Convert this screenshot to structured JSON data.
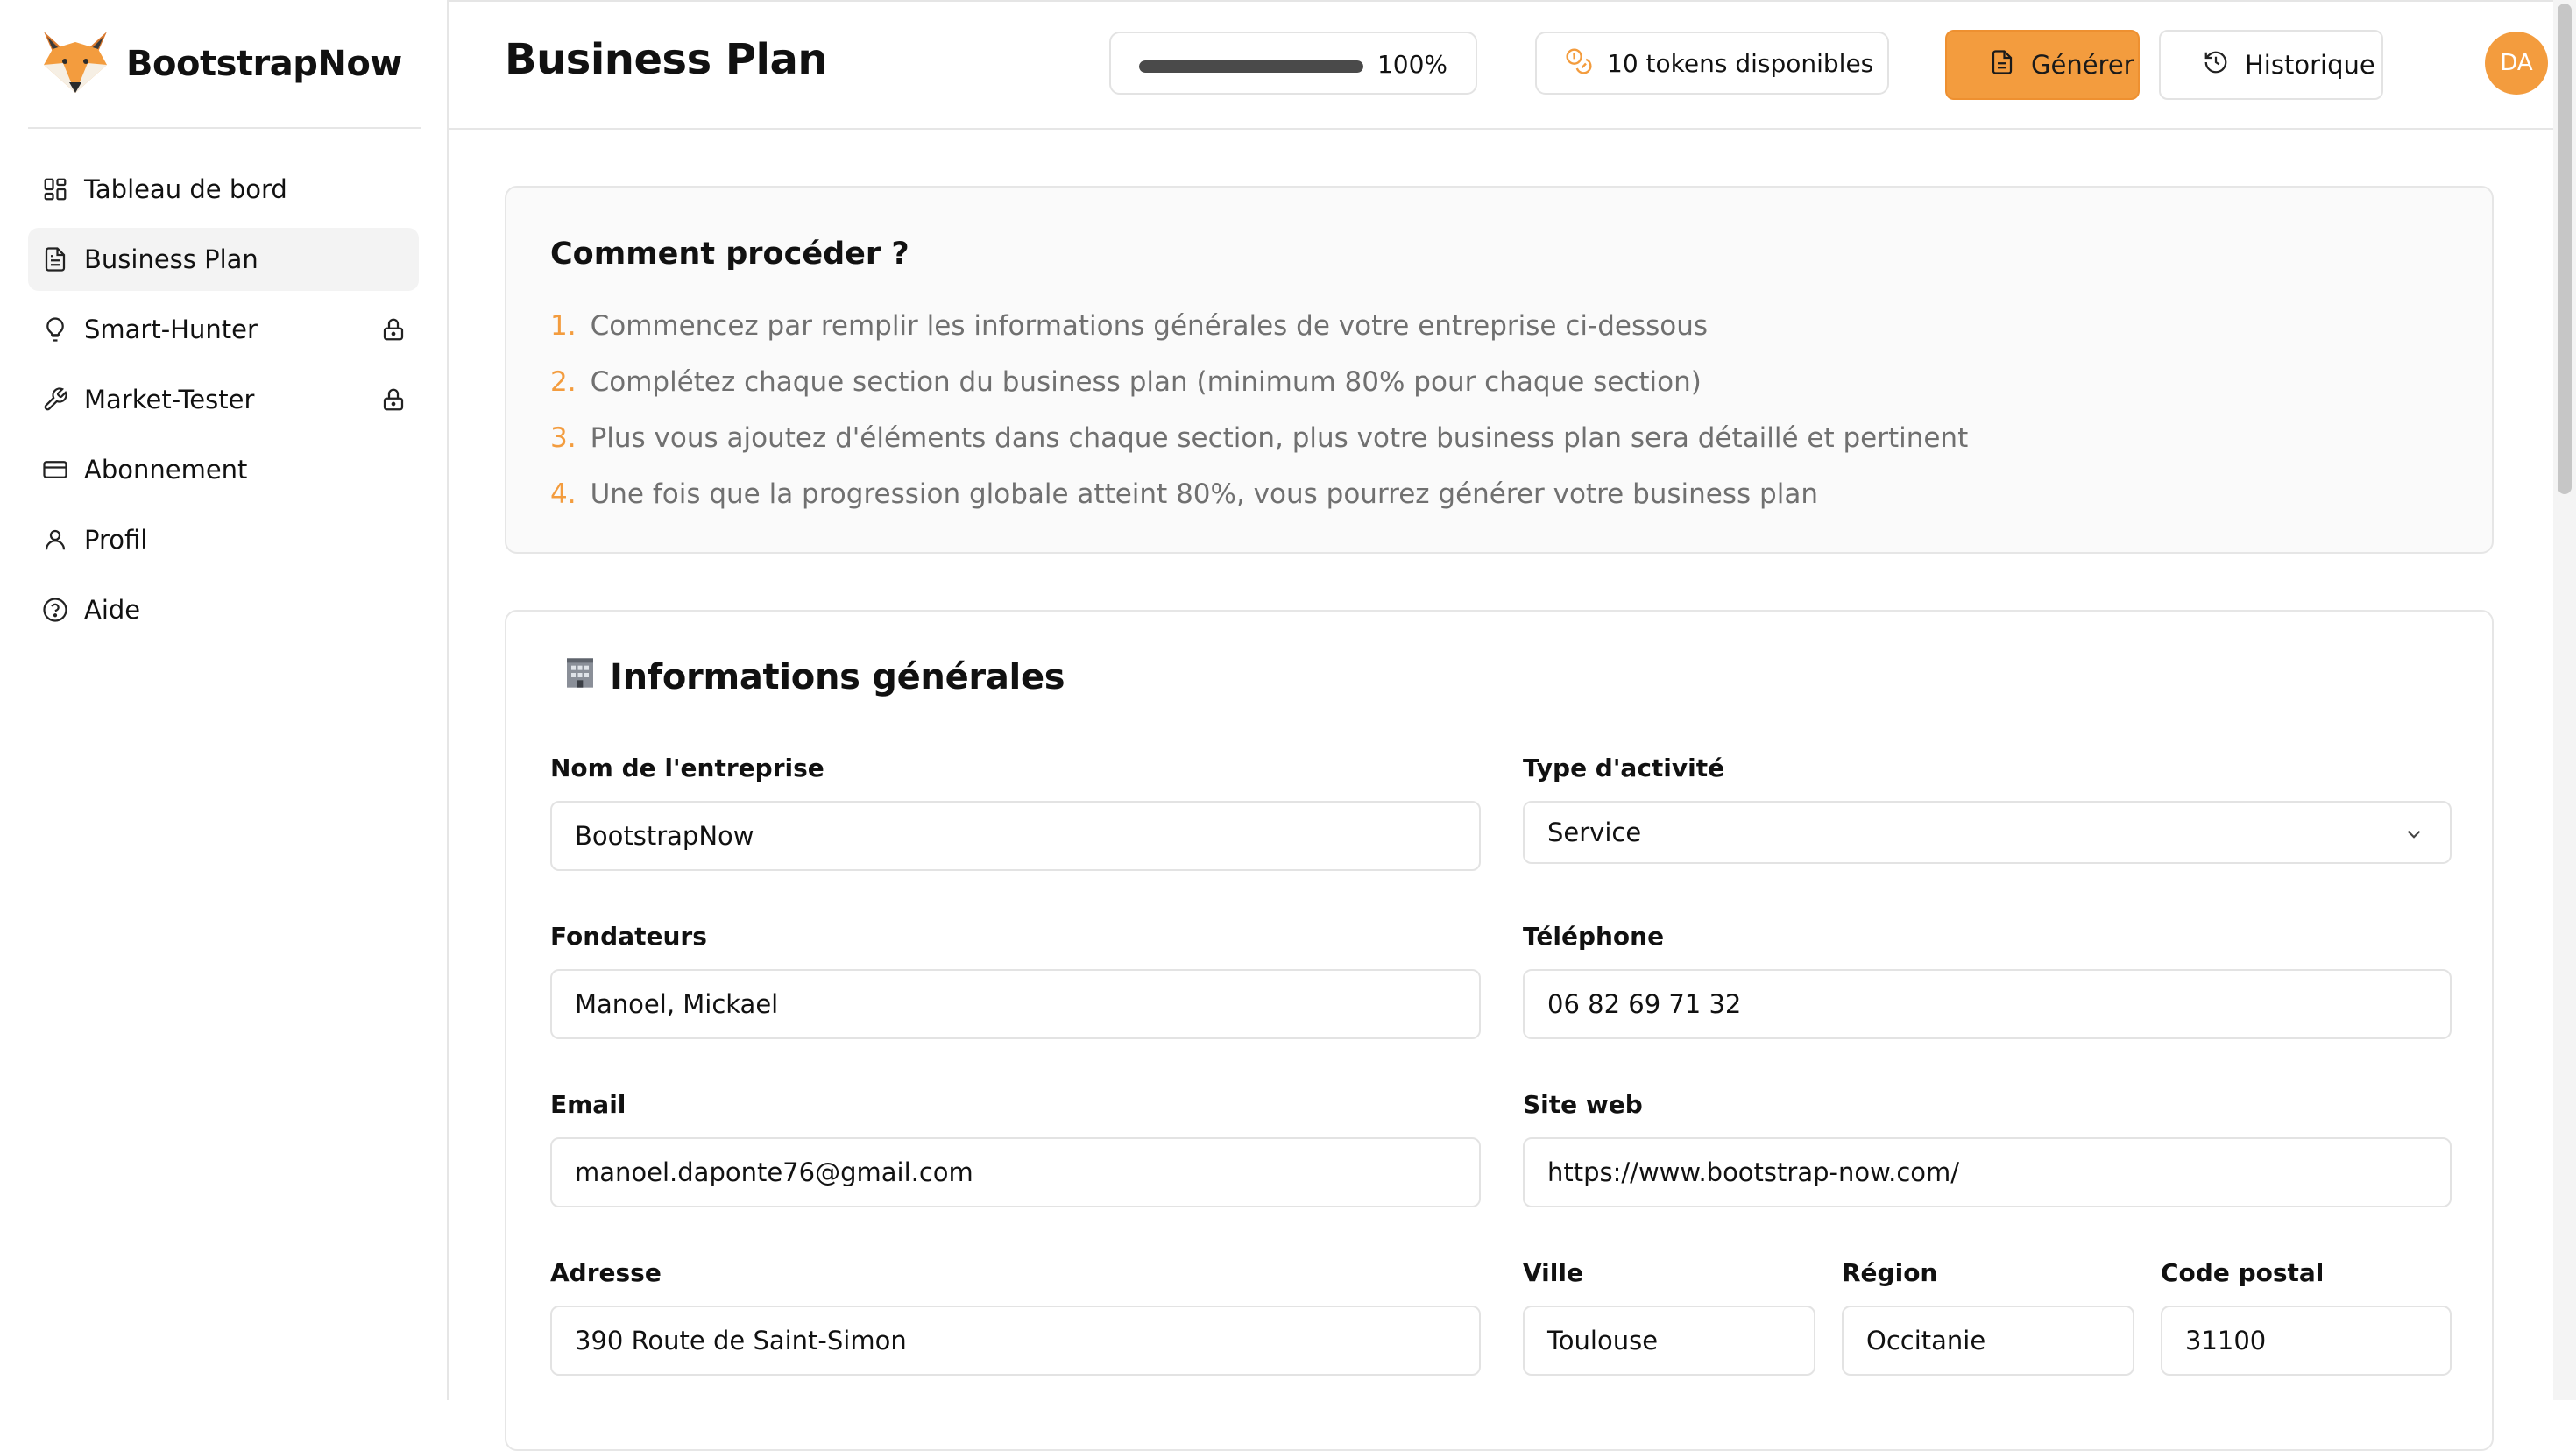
{
  "brand": {
    "name": "BootstrapNow"
  },
  "sidebar": {
    "items": [
      {
        "label": "Tableau de bord",
        "icon": "dashboard-icon"
      },
      {
        "label": "Business Plan",
        "icon": "document-icon"
      },
      {
        "label": "Smart-Hunter",
        "icon": "lightbulb-icon",
        "locked": true
      },
      {
        "label": "Market-Tester",
        "icon": "wrench-icon",
        "locked": true
      },
      {
        "label": "Abonnement",
        "icon": "credit-card-icon"
      },
      {
        "label": "Profil",
        "icon": "user-icon"
      },
      {
        "label": "Aide",
        "icon": "help-circle-icon"
      }
    ],
    "active_index": 1
  },
  "header": {
    "title": "Business Plan",
    "progress": {
      "value": 100,
      "label": "100%"
    },
    "tokens_label": "10 tokens disponibles",
    "generate_label": "Générer",
    "history_label": "Historique",
    "avatar_initials": "DA"
  },
  "how_to": {
    "title": "Comment procéder ?",
    "steps": [
      {
        "num": "1.",
        "text": "Commencez par remplir les informations générales de votre entreprise ci-dessous"
      },
      {
        "num": "2.",
        "text": "Complétez chaque section du business plan (minimum 80% pour chaque section)"
      },
      {
        "num": "3.",
        "text": "Plus vous ajoutez d'éléments dans chaque section, plus votre business plan sera détaillé et pertinent"
      },
      {
        "num": "4.",
        "text": "Une fois que la progression globale atteint 80%, vous pourrez générer votre business plan"
      }
    ]
  },
  "info": {
    "title": "Informations générales",
    "icon": "building-icon",
    "fields": {
      "company_name": {
        "label": "Nom de l'entreprise",
        "value": "BootstrapNow"
      },
      "activity_type": {
        "label": "Type d'activité",
        "value": "Service"
      },
      "founders": {
        "label": "Fondateurs",
        "value": "Manoel, Mickael"
      },
      "phone": {
        "label": "Téléphone",
        "value": "06 82 69 71 32"
      },
      "email": {
        "label": "Email",
        "value": "manoel.daponte76@gmail.com"
      },
      "website": {
        "label": "Site web",
        "value": "https://www.bootstrap-now.com/"
      },
      "address": {
        "label": "Adresse",
        "value": "390 Route de Saint-Simon"
      },
      "city": {
        "label": "Ville",
        "value": "Toulouse"
      },
      "region": {
        "label": "Région",
        "value": "Occitanie"
      },
      "postal_code": {
        "label": "Code postal",
        "value": "31100"
      }
    }
  },
  "colors": {
    "accent": "#f39c3e",
    "border": "#e3e3e3",
    "muted_text": "#707070"
  }
}
